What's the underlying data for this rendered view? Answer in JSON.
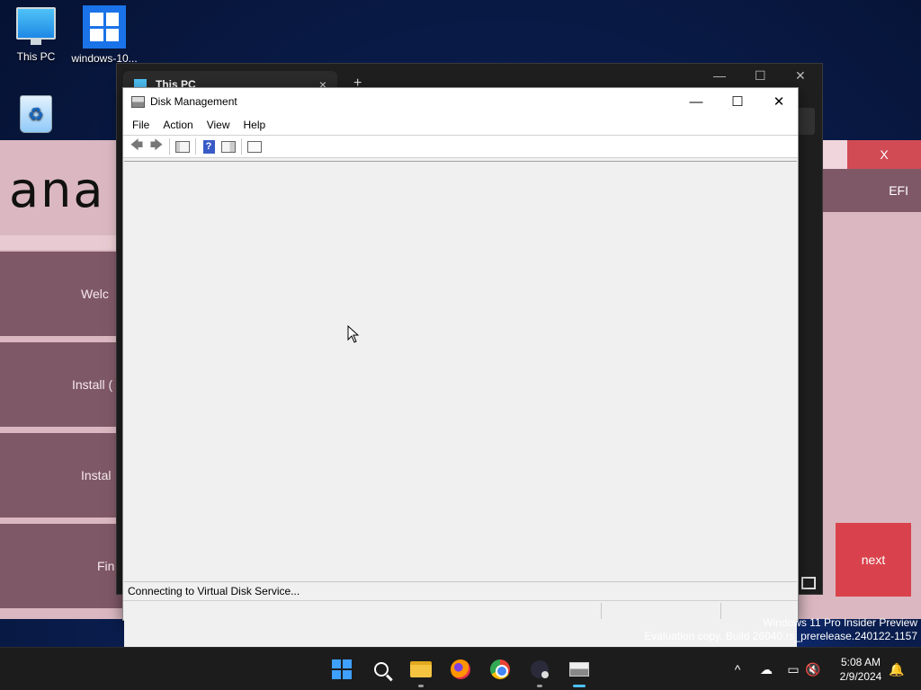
{
  "desktop": {
    "icons": [
      {
        "label": "This PC"
      },
      {
        "label": "windows-10..."
      },
      {
        "label": "Recycle Bin"
      }
    ]
  },
  "installer": {
    "logo_text": "ana",
    "buttons": [
      "Welc",
      "Install (",
      "Instal",
      "Fin"
    ],
    "close_label": "X",
    "efi_label": "EFI",
    "next_label": "next"
  },
  "explorer": {
    "tab_title": "This PC",
    "tab_close": "×",
    "new_tab": "+"
  },
  "disk_management": {
    "title": "Disk Management",
    "controls": {
      "minimize": "—",
      "maximize": "☐",
      "close": "✕"
    },
    "menu": [
      "File",
      "Action",
      "View",
      "Help"
    ],
    "toolbar": [
      "back-icon",
      "forward-icon",
      "show-hide-console-tree-icon",
      "help-icon",
      "show-hide-action-pane-icon",
      "properties-icon"
    ],
    "status_text": "Connecting to Virtual Disk Service..."
  },
  "watermark": {
    "line1": "Windows 11 Pro Insider Preview",
    "line2": "Evaluation copy. Build 26040.rs_prerelease.240122-1157"
  },
  "taskbar": {
    "apps": [
      "start-icon",
      "search-icon",
      "file-explorer-icon",
      "firefox-icon",
      "chrome-icon",
      "app-icon",
      "disk-management-icon"
    ],
    "tray": {
      "chevron": "^",
      "time": "5:08 AM",
      "date": "2/9/2024"
    }
  },
  "colors": {
    "installer_bg": "#dbb8c1",
    "installer_btn": "#7f5867",
    "installer_red": "#d9424c",
    "taskbar": "#1c1c1c",
    "accent": "#4cc2ff"
  }
}
